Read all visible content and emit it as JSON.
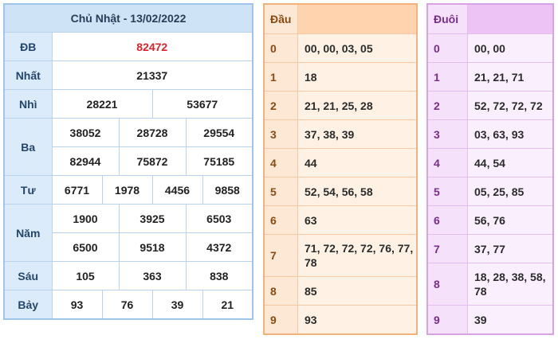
{
  "results": {
    "title": "Chủ Nhật - 13/02/2022",
    "db": {
      "label": "ĐB",
      "value": "82472"
    },
    "nhat": {
      "label": "Nhất",
      "value": "21337"
    },
    "nhi": {
      "label": "Nhì",
      "values": [
        "28221",
        "53677"
      ]
    },
    "ba": {
      "label": "Ba",
      "values": [
        "38052",
        "28728",
        "29554",
        "82944",
        "75872",
        "75185"
      ]
    },
    "tu": {
      "label": "Tư",
      "values": [
        "6771",
        "1978",
        "4456",
        "9858"
      ]
    },
    "nam": {
      "label": "Năm",
      "values": [
        "1900",
        "3925",
        "6503",
        "6500",
        "9518",
        "4372"
      ]
    },
    "sau": {
      "label": "Sáu",
      "values": [
        "105",
        "363",
        "838"
      ]
    },
    "bay": {
      "label": "Bảy",
      "values": [
        "93",
        "76",
        "39",
        "21"
      ]
    }
  },
  "head": {
    "title": "Đầu",
    "rows": [
      {
        "key": "0",
        "value": "00, 00, 03, 05"
      },
      {
        "key": "1",
        "value": "18"
      },
      {
        "key": "2",
        "value": "21, 21, 25, 28"
      },
      {
        "key": "3",
        "value": "37, 38, 39"
      },
      {
        "key": "4",
        "value": "44"
      },
      {
        "key": "5",
        "value": "52, 54, 56, 58"
      },
      {
        "key": "6",
        "value": "63"
      },
      {
        "key": "7",
        "value": "71, 72, 72, 72, 76, 77, 78"
      },
      {
        "key": "8",
        "value": "85"
      },
      {
        "key": "9",
        "value": "93"
      }
    ]
  },
  "tail": {
    "title": "Đuôi",
    "rows": [
      {
        "key": "0",
        "value": "00, 00"
      },
      {
        "key": "1",
        "value": "21, 21, 71"
      },
      {
        "key": "2",
        "value": "52, 72, 72, 72"
      },
      {
        "key": "3",
        "value": "03, 63, 93"
      },
      {
        "key": "4",
        "value": "44, 54"
      },
      {
        "key": "5",
        "value": "05, 25, 85"
      },
      {
        "key": "6",
        "value": "56, 76"
      },
      {
        "key": "7",
        "value": "37, 77"
      },
      {
        "key": "8",
        "value": "18, 28, 38, 58, 78"
      },
      {
        "key": "9",
        "value": "39"
      }
    ]
  },
  "colors": {
    "results_border": "#9fc6ea",
    "special_prize": "#e0202a",
    "head_header": "#ffd3ad",
    "tail_header": "#edc3f6"
  }
}
